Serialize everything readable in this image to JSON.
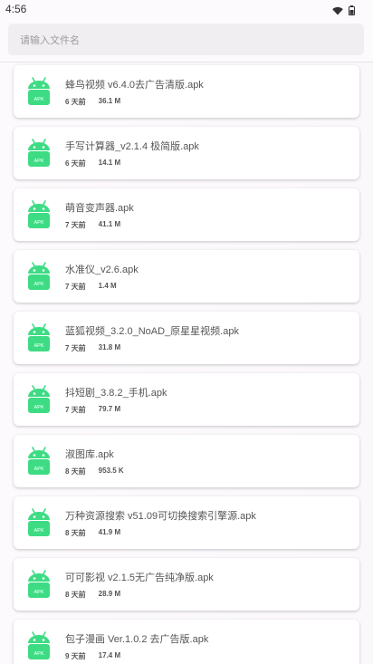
{
  "status_bar": {
    "time": "4:56",
    "icons": [
      "wifi-icon",
      "battery-icon"
    ]
  },
  "search": {
    "placeholder": "请输入文件名"
  },
  "colors": {
    "android_green": "#3ddc84",
    "card_bg": "#ffffff",
    "page_bg": "#fdfafd"
  },
  "files": [
    {
      "name": "蜂鸟视频 v6.4.0去广告清版.apk",
      "time": "6 天前",
      "size": "36.1 M",
      "icon_label": "APK"
    },
    {
      "name": "手写计算器_v2.1.4 极简版.apk",
      "time": "6 天前",
      "size": "14.1 M",
      "icon_label": "APK"
    },
    {
      "name": "萌音变声器.apk",
      "time": "7 天前",
      "size": "41.1 M",
      "icon_label": "APK"
    },
    {
      "name": "水准仪_v2.6.apk",
      "time": "7 天前",
      "size": "1.4 M",
      "icon_label": "APK"
    },
    {
      "name": "蓝狐视频_3.2.0_NoAD_原星星视频.apk",
      "time": "7 天前",
      "size": "31.8 M",
      "icon_label": "APK"
    },
    {
      "name": "抖短剧_3.8.2_手机.apk",
      "time": "7 天前",
      "size": "79.7 M",
      "icon_label": "APK"
    },
    {
      "name": "淑图库.apk",
      "time": "8 天前",
      "size": "953.5 K",
      "icon_label": "APK"
    },
    {
      "name": "万种资源搜索 v51.09可切换搜索引擎源.apk",
      "time": "8 天前",
      "size": "41.9 M",
      "icon_label": "APK"
    },
    {
      "name": "可可影视 v2.1.5无广告纯净版.apk",
      "time": "8 天前",
      "size": "28.9 M",
      "icon_label": "APK"
    },
    {
      "name": "包子漫画 Ver.1.0.2 去广告版.apk",
      "time": "9 天前",
      "size": "17.4 M",
      "icon_label": "APK"
    }
  ]
}
